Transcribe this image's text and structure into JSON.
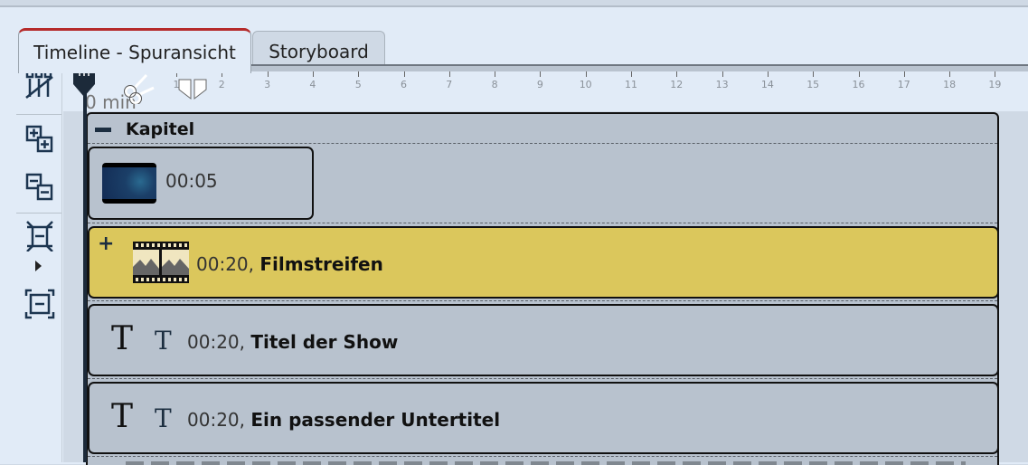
{
  "tabs": [
    {
      "label": "Timeline - Spuransicht",
      "active": true
    },
    {
      "label": "Storyboard",
      "active": false
    }
  ],
  "toolbar": {
    "tools": [
      {
        "icon": "track-settings-icon"
      },
      {
        "icon": "expand-all-icon"
      },
      {
        "icon": "collapse-all-icon"
      },
      {
        "icon": "shrink-tracks-icon"
      },
      {
        "icon": "enlarge-tracks-icon"
      }
    ]
  },
  "ruler": {
    "zero_label": "0 min",
    "ticks": [
      "1",
      "2",
      "3",
      "4",
      "5",
      "6",
      "7",
      "8",
      "9",
      "10",
      "11",
      "12",
      "13",
      "14",
      "15",
      "16",
      "17",
      "18",
      "19"
    ]
  },
  "chapter": {
    "title": "Kapitel",
    "collapse_symbol": "−"
  },
  "clips": [
    {
      "duration": "00:05",
      "name": "",
      "type": "image"
    },
    {
      "duration": "00:20,",
      "name": "Filmstreifen",
      "type": "filmstrip",
      "expand_symbol": "+"
    },
    {
      "duration": "00:20,",
      "name": "Titel der Show",
      "type": "text"
    },
    {
      "duration": "00:20,",
      "name": "Ein passender Untertitel",
      "type": "text"
    }
  ],
  "colors": {
    "active_tab_accent": "#b52a2a",
    "filmstrip_clip": "#dbc75c",
    "clip_bg": "#b8c2ce"
  }
}
